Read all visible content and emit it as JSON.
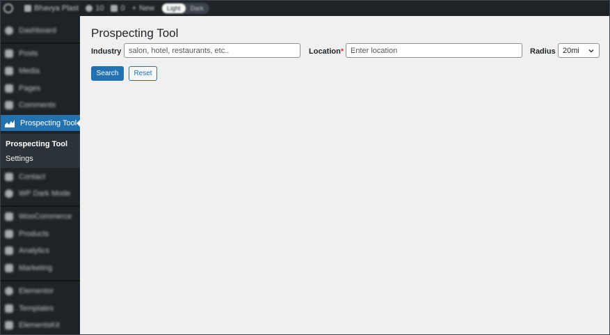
{
  "admin_bar": {
    "site_name": "Bhavya Plast",
    "updates_count": "10",
    "comments_count": "0",
    "new_label": "New",
    "mode_light": "Light",
    "mode_dark": "Dark"
  },
  "sidebar": {
    "items": [
      {
        "label": "Dashboard",
        "icon": "dashboard-icon"
      },
      {
        "label": "Posts",
        "icon": "pin-icon"
      },
      {
        "label": "Media",
        "icon": "media-icon"
      },
      {
        "label": "Pages",
        "icon": "page-icon"
      },
      {
        "label": "Comments",
        "icon": "comment-icon"
      },
      {
        "label": "Prospecting Tool",
        "icon": "chart-icon"
      },
      {
        "label": "Contact",
        "icon": "mail-icon"
      },
      {
        "label": "WP Dark Mode",
        "icon": "moon-icon"
      },
      {
        "label": "WooCommerce",
        "icon": "woo-icon"
      },
      {
        "label": "Products",
        "icon": "box-icon"
      },
      {
        "label": "Analytics",
        "icon": "analytics-icon"
      },
      {
        "label": "Marketing",
        "icon": "megaphone-icon"
      },
      {
        "label": "Elementor",
        "icon": "elementor-icon"
      },
      {
        "label": "Templates",
        "icon": "folder-icon"
      },
      {
        "label": "ElementsKit",
        "icon": "kit-icon"
      }
    ],
    "submenu": [
      {
        "label": "Prospecting Tool",
        "active": true
      },
      {
        "label": "Settings",
        "active": false
      }
    ],
    "accent": "#2271b1"
  },
  "main": {
    "title": "Prospecting Tool",
    "industry_label": "Industry",
    "industry_placeholder": "salon, hotel, restaurants, etc..",
    "industry_value": "",
    "location_label": "Location",
    "location_required": "*",
    "location_placeholder": "Enter location",
    "location_value": "",
    "radius_label": "Radius",
    "radius_value": "20mi",
    "search_button": "Search",
    "reset_button": "Reset"
  }
}
